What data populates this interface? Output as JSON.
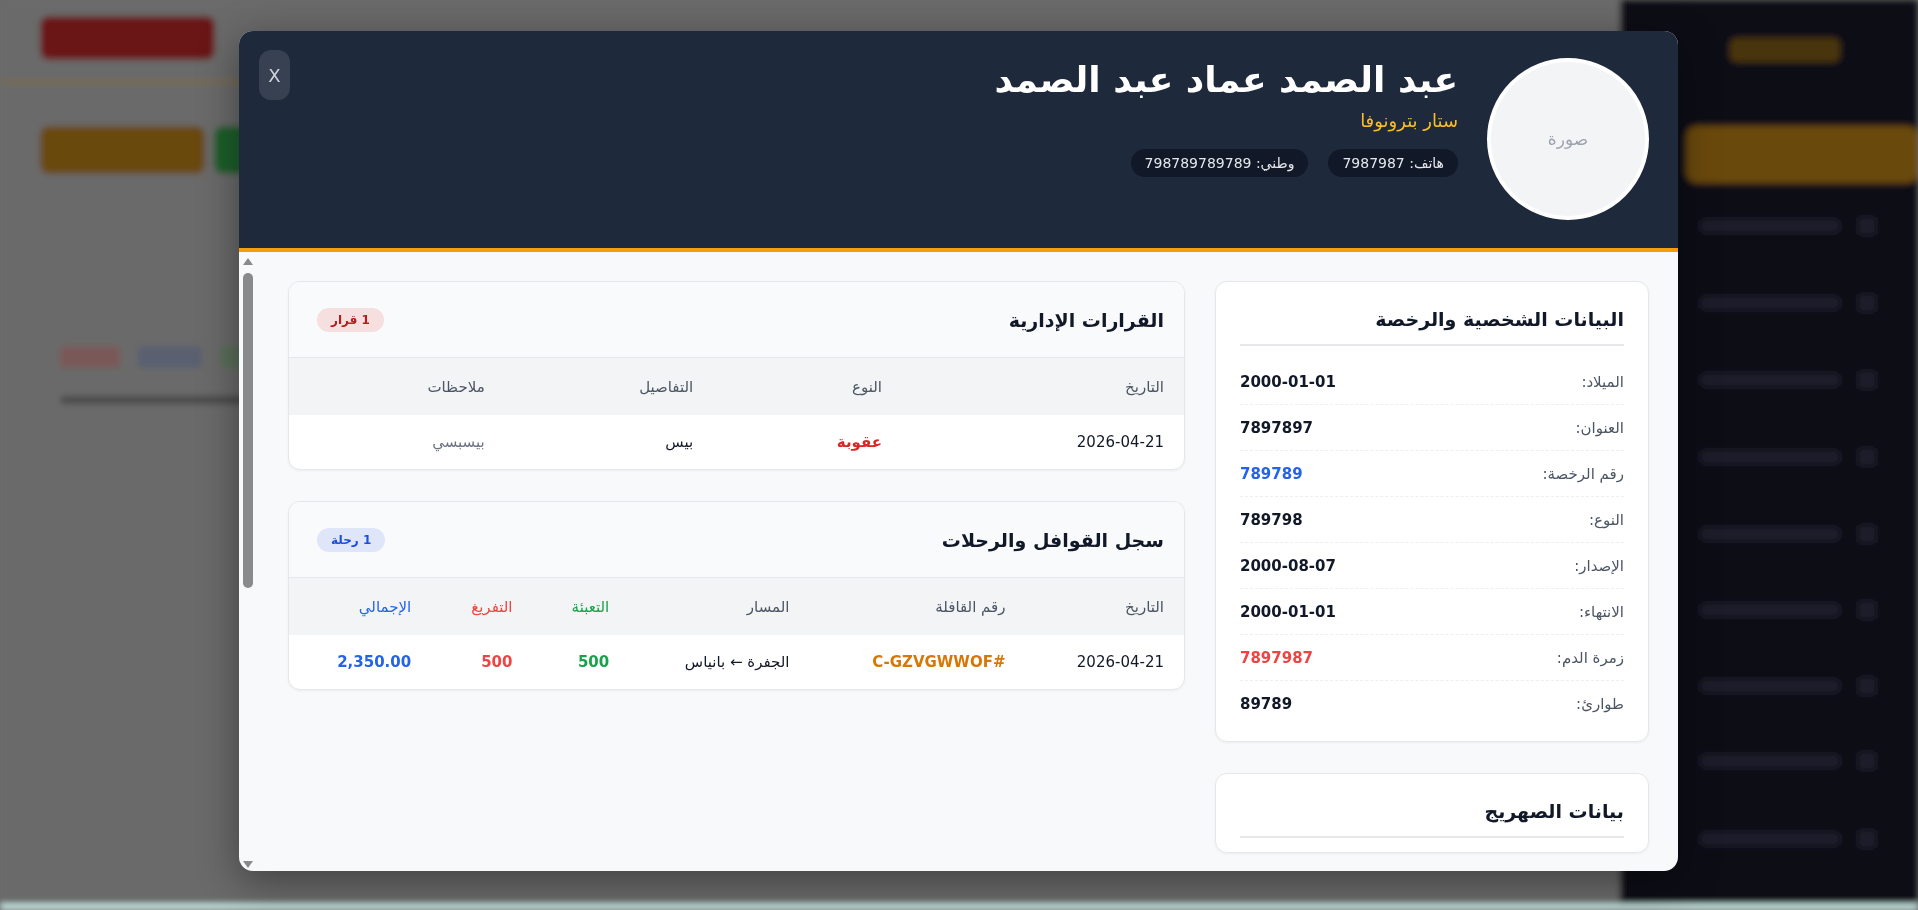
{
  "dialog": {
    "close_button": "X",
    "header": {
      "avatar_label": "صورة",
      "name": "عبد الصمد عماد عبد الصمد",
      "subtitle": "ستار بترونوفا",
      "chips": [
        "هاتف: 7987987",
        "وطني: 798789789789"
      ]
    },
    "decisions": {
      "title": "القرارات الإدارية",
      "badge": {
        "text": "1 قرار",
        "color": "#b91c1c"
      },
      "columns": [
        {
          "label": "التاريخ"
        },
        {
          "label": "النوع"
        },
        {
          "label": "التفاصيل"
        },
        {
          "label": "ملاحظات"
        }
      ],
      "rows": [
        [
          {
            "text": "2026-04-21"
          },
          {
            "text": "عقوبة",
            "color": "#dc2626",
            "bold": true
          },
          {
            "text": "بيس"
          },
          {
            "text": "بيسبسي",
            "color": "#6b7280"
          }
        ]
      ]
    },
    "trips": {
      "title": "سجل القوافل والرحلات",
      "badge": {
        "text": "1 رحلة",
        "color": "#1d4ed8"
      },
      "columns": [
        {
          "label": "التاريخ"
        },
        {
          "label": "رقم القافلة"
        },
        {
          "label": "المسار"
        },
        {
          "label": "التعبئة",
          "color": "#16a34a"
        },
        {
          "label": "التفريغ",
          "color": "#ef4444"
        },
        {
          "label": "الإجمالي",
          "color": "#2563eb"
        }
      ],
      "rows": [
        [
          {
            "text": "2026-04-21"
          },
          {
            "text": "C-GZVGWWOF#",
            "color": "#d97706",
            "bold": true
          },
          {
            "text": "الجفرة ← بانياس"
          },
          {
            "text": "500",
            "color": "#16a34a",
            "bold": true
          },
          {
            "text": "500",
            "color": "#ef4444",
            "bold": true
          },
          {
            "text": "2,350.00",
            "color": "#2563eb",
            "bold": true
          }
        ]
      ]
    },
    "personal": {
      "title": "البيانات الشخصية والرخصة",
      "fields": [
        {
          "label": "الميلاد:",
          "value": "2000-01-01"
        },
        {
          "label": "العنوان:",
          "value": "7897897"
        },
        {
          "label": "رقم الرخصة:",
          "value": "789789",
          "color": "#2563eb"
        },
        {
          "label": "النوع:",
          "value": "789798"
        },
        {
          "label": "الإصدار:",
          "value": "2000-08-07"
        },
        {
          "label": "الانتهاء:",
          "value": "2000-01-01"
        },
        {
          "label": "زمرة الدم:",
          "value": "7897987",
          "color": "#ef4444"
        },
        {
          "label": "طوارئ:",
          "value": "89789"
        }
      ]
    },
    "tank": {
      "title": "بيانات الصهريج"
    }
  }
}
